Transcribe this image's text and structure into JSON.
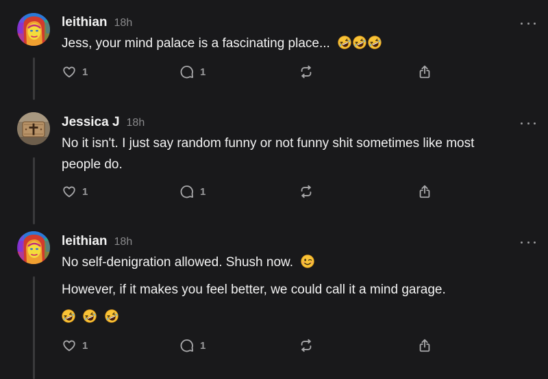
{
  "posts": [
    {
      "username": "leithian",
      "time": "18h",
      "paragraphs": [
        "Jess, your mind palace is a fascinating place..."
      ],
      "emoji_after_text": [
        "rolling-on-floor-laughing",
        "rolling-on-floor-laughing",
        "rolling-on-floor-laughing"
      ],
      "likes": "1",
      "replies": "1"
    },
    {
      "username": "Jessica J",
      "time": "18h",
      "paragraphs": [
        "No it isn't. I just say random funny or not funny shit sometimes like most",
        "people do."
      ],
      "likes": "1",
      "replies": "1"
    },
    {
      "username": "leithian",
      "time": "18h",
      "paragraphs": [
        "No self-denigration allowed. Shush now.",
        "However, if it makes you feel better, we could call it a mind garage."
      ],
      "emoji_after_text": [
        "winking-face"
      ],
      "emoji_line": [
        "rolling-on-floor-laughing",
        "rolling-on-floor-laughing",
        "rolling-on-floor-laughing"
      ],
      "likes": "1",
      "replies": "1"
    }
  ],
  "icons": {
    "like": "heart-icon",
    "reply": "comment-icon",
    "repost": "repost-icon",
    "share": "share-icon",
    "more": "more-dots-icon"
  },
  "colors": {
    "background": "#19191b",
    "text": "#f3f3f3",
    "muted": "#8a8a8c",
    "thread_line": "#3a3a3c"
  }
}
